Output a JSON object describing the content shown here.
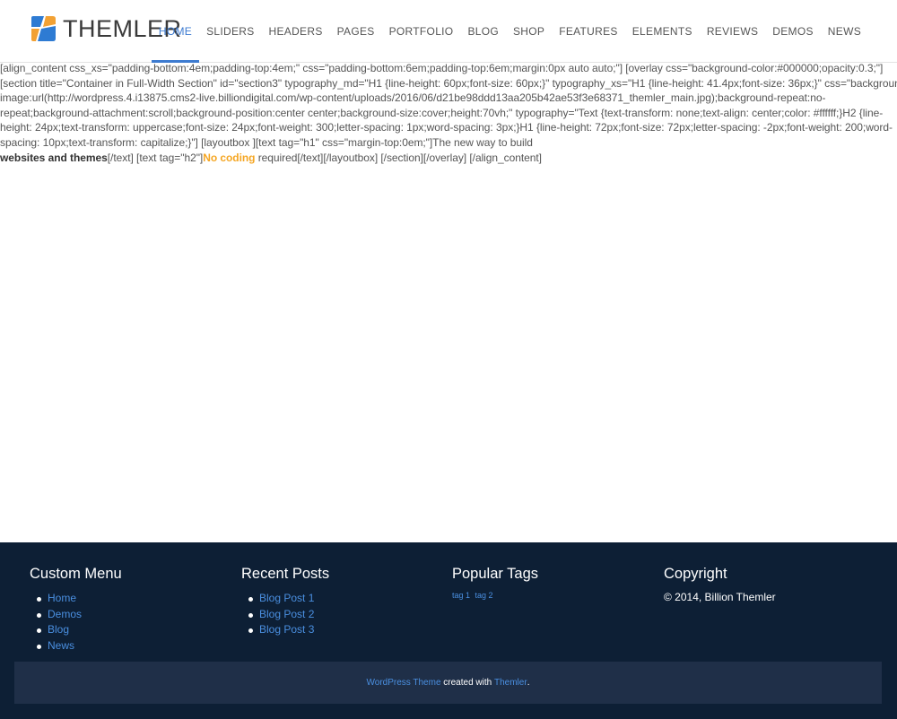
{
  "logo": {
    "text": "THEMLER",
    "colors": {
      "blue": "#2e7bd3",
      "orange": "#f2a134"
    }
  },
  "nav": {
    "items": [
      {
        "label": "HOME",
        "active": true
      },
      {
        "label": "SLIDERS"
      },
      {
        "label": "HEADERS"
      },
      {
        "label": "PAGES"
      },
      {
        "label": "PORTFOLIO"
      },
      {
        "label": "BLOG"
      },
      {
        "label": "SHOP"
      },
      {
        "label": "FEATURES"
      },
      {
        "label": "ELEMENTS"
      },
      {
        "label": "REVIEWS"
      },
      {
        "label": "DEMOS"
      },
      {
        "label": "NEWS"
      }
    ],
    "accent": "#3d7bd0"
  },
  "content": {
    "line1": "[align_content css_xs=\"padding-bottom:4em;padding-top:4em;\" css=\"padding-bottom:6em;padding-top:6em;margin:0px auto auto;\"] [overlay css=\"background-color:#000000;opacity:0.3;\"]",
    "line2": "[section title=\"Container in Full-Width Section\" id=\"section3\" typography_md=\"H1 {line-height: 60px;font-size: 60px;}\" typography_xs=\"H1 {line-height: 41.4px;font-size: 36px;}\" css=\"background-",
    "line3": "image:url(http://wordpress.4.i13875.cms2-live.billiondigital.com/wp-content/uploads/2016/06/d21be98ddd13aa205b42ae53f3e68371_themler_main.jpg);background-repeat:no-",
    "line4": "repeat;background-attachment:scroll;background-position:center center;background-size:cover;height:70vh;\" typography=\"Text {text-transform: none;text-align: center;color: #ffffff;}H2 {line-",
    "line5": "height: 24px;text-transform: uppercase;font-size: 24px;font-weight: 300;letter-spacing: 1px;word-spacing: 3px;}H1 {line-height: 72px;font-size: 72px;letter-spacing: -2px;font-weight: 200;word-",
    "line6": "spacing: 10px;text-transform: capitalize;}\"] [layoutbox ][text tag=\"h1\" css=\"margin-top:0em;\"]The new way to build",
    "line7_bold": "websites and themes",
    "line7_a": "[/text] [text tag=\"h2\"]",
    "line7_orange": "No coding",
    "line7_b": " required[/text][/layoutbox] [/section][/overlay] [/align_content]"
  },
  "footer": {
    "custom_menu": {
      "title": "Custom Menu",
      "items": [
        "Home",
        "Demos",
        "Blog",
        "News"
      ]
    },
    "recent_posts": {
      "title": "Recent Posts",
      "items": [
        "Blog Post 1",
        "Blog Post 2",
        "Blog Post 3"
      ]
    },
    "popular_tags": {
      "title": "Popular Tags",
      "tags": [
        "tag 1",
        "tag 2"
      ]
    },
    "copyright": {
      "title": "Copyright",
      "text": "© 2014, Billion Themler"
    },
    "bar": {
      "link1": "WordPress Theme",
      "middle": " created with ",
      "link2": "Themler",
      "end": "."
    },
    "colors": {
      "bg": "#0d1f35",
      "bar_bg": "#1f2f48",
      "link": "#4a8fe0"
    }
  }
}
